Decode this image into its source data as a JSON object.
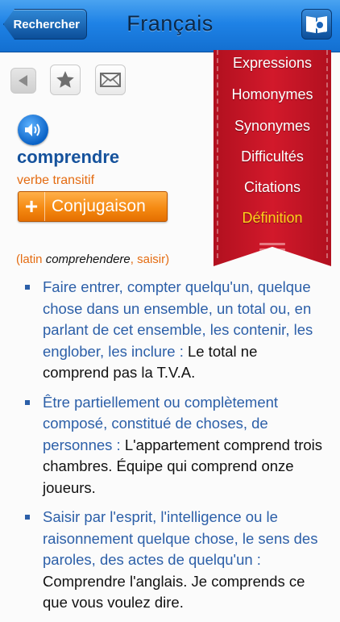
{
  "header": {
    "back_label": "Rechercher",
    "title": "Français",
    "book_icon": "book-search-icon"
  },
  "toolbar": {
    "prev_icon": "triangle-left-icon",
    "star_icon": "star-icon",
    "mail_icon": "envelope-icon"
  },
  "entry": {
    "word": "comprendre",
    "pos": "verbe transitif",
    "conjugation_button": "Conjugaison",
    "conjugation_plus": "+",
    "etymology": {
      "open": "(latin ",
      "latin": "comprehendere",
      "sep": ", ",
      "meaning": "saisir",
      "close": ")"
    }
  },
  "menu": {
    "items": [
      {
        "label": "Expressions"
      },
      {
        "label": "Homonymes"
      },
      {
        "label": "Synonymes"
      },
      {
        "label": "Difficultés"
      },
      {
        "label": "Citations"
      },
      {
        "label": "Définition"
      }
    ],
    "active_index": 5,
    "active_color": "#ffd21a",
    "color": "#c8142a"
  },
  "definitions": [
    {
      "text": "Faire entrer, compter quelqu'un, quelque chose dans un ensemble, un total ou, en parlant de cet ensemble, les contenir, les englober, les inclure : ",
      "example": "Le total ne comprend pas la T.V.A."
    },
    {
      "text": "Être partiellement ou complètement composé, constitué de choses, de personnes : ",
      "example": "L'appartement comprend trois chambres. Équipe qui comprend onze joueurs."
    },
    {
      "text": "Saisir par l'esprit, l'intelligence ou le raisonnement quelque chose, le sens des paroles, des actes de quelqu'un : ",
      "example": "Comprendre l'anglais. Je comprends ce que vous voulez dire."
    }
  ],
  "colors": {
    "header": "#1e82e6",
    "word": "#15529c",
    "accent_orange": "#e46c12",
    "definition_text": "#2c5fa8"
  }
}
